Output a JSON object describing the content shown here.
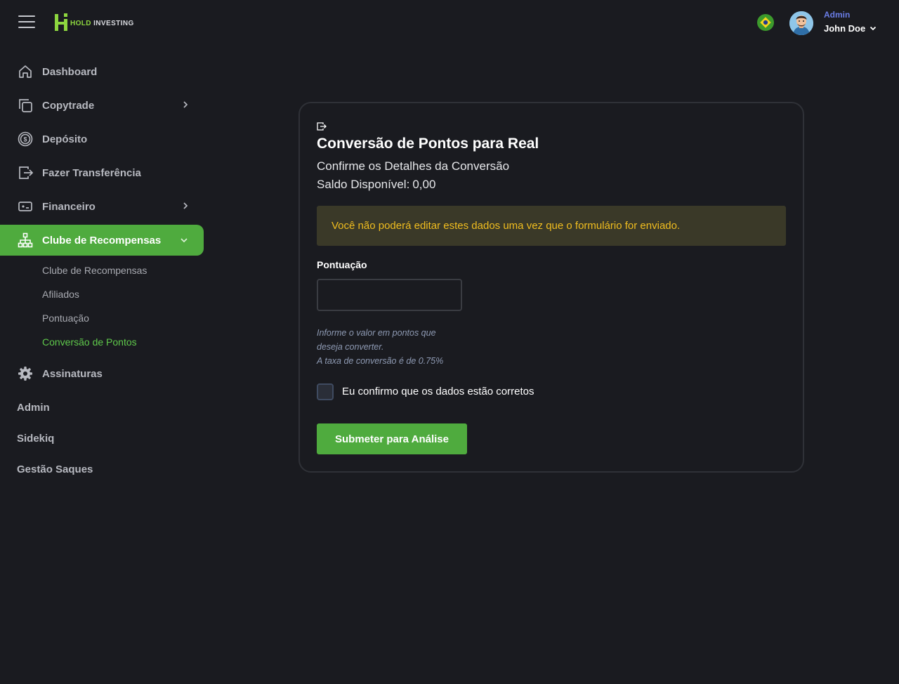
{
  "header": {
    "brand": {
      "part1": "HOLD",
      "part2": "INVESTING"
    },
    "user_role": "Admin",
    "user_name": "John Doe",
    "accent_color": "#4fab3e"
  },
  "sidebar": {
    "items": [
      {
        "label": "Dashboard",
        "icon": "home-icon"
      },
      {
        "label": "Copytrade",
        "icon": "copy-icon",
        "has_submenu": true
      },
      {
        "label": "Depósito",
        "icon": "dollar-coin-icon"
      },
      {
        "label": "Fazer Transferência",
        "icon": "transfer-icon"
      },
      {
        "label": "Financeiro",
        "icon": "cash-icon",
        "has_submenu": true
      },
      {
        "label": "Clube de Recompensas",
        "icon": "hierarchy-icon",
        "has_submenu": true,
        "active": true
      }
    ],
    "subitems": [
      {
        "label": "Clube de Recompensas"
      },
      {
        "label": "Afiliados"
      },
      {
        "label": "Pontuação"
      },
      {
        "label": "Conversão de Pontos",
        "active": true
      }
    ],
    "extra_items": [
      {
        "label": "Assinaturas",
        "icon": "gear-icon"
      }
    ],
    "plain_items": [
      {
        "label": "Admin"
      },
      {
        "label": "Sidekiq"
      },
      {
        "label": "Gestão Saques"
      }
    ]
  },
  "form": {
    "title": "Conversão de Pontos para Real",
    "subtitle": "Confirme os Detalhes da Conversão",
    "balance_label": "Saldo Disponível:",
    "balance_value": "0,00",
    "alert": "Você não poderá editar estes dados uma vez que o formulário for enviado.",
    "field_label": "Pontuação",
    "field_value": "",
    "hint_lines": [
      "Informe o valor em pontos que",
      "deseja converter.",
      "A taxa de conversão é de 0.75%"
    ],
    "confirm_label": "Eu confirmo que os dados estão corretos",
    "submit_label": "Submeter para Análise"
  }
}
